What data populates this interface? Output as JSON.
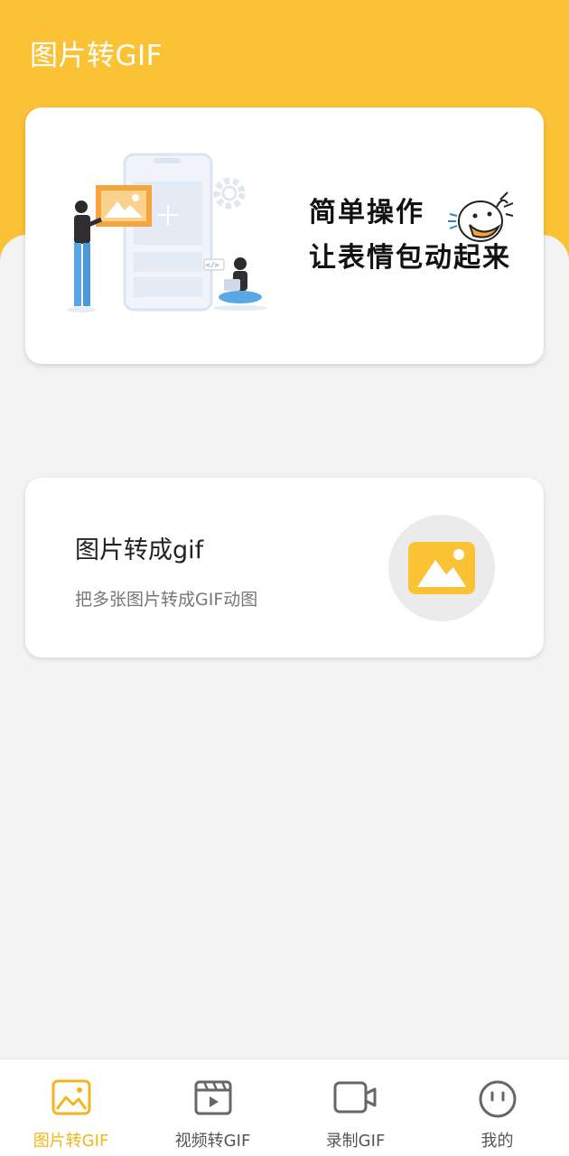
{
  "header": {
    "title": "图片转GIF"
  },
  "banner": {
    "line1": "简单操作",
    "line2": "让表情包动起来"
  },
  "feature": {
    "title": "图片转成gif",
    "subtitle": "把多张图片转成GIF动图",
    "icon": "image-icon"
  },
  "tabbar": {
    "items": [
      {
        "label": "图片转GIF",
        "icon": "image-icon",
        "active": true
      },
      {
        "label": "视频转GIF",
        "icon": "video-clapper-icon",
        "active": false
      },
      {
        "label": "录制GIF",
        "icon": "video-camera-icon",
        "active": false
      },
      {
        "label": "我的",
        "icon": "face-icon",
        "active": false
      }
    ]
  },
  "colors": {
    "accent": "#fcc235",
    "active_tab": "#f2b51e",
    "background": "#f3f3f3"
  }
}
